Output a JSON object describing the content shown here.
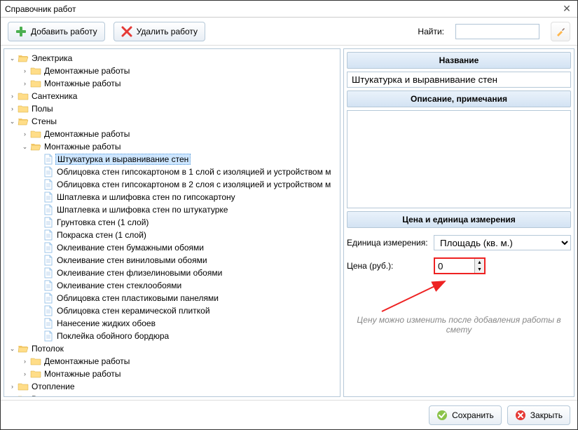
{
  "window": {
    "title": "Справочник работ"
  },
  "toolbar": {
    "add_label": "Добавить работу",
    "delete_label": "Удалить работу",
    "search_label": "Найти:"
  },
  "tree": [
    {
      "label": "Электрика",
      "icon": "folder-open",
      "expanded": true,
      "children": [
        {
          "label": "Демонтажные работы",
          "icon": "folder",
          "expanded": false,
          "children": true
        },
        {
          "label": "Монтажные работы",
          "icon": "folder",
          "expanded": false,
          "children": true
        }
      ]
    },
    {
      "label": "Сантехника",
      "icon": "folder",
      "expanded": false,
      "children": true
    },
    {
      "label": "Полы",
      "icon": "folder",
      "expanded": false,
      "children": true
    },
    {
      "label": "Стены",
      "icon": "folder-open",
      "expanded": true,
      "children": [
        {
          "label": "Демонтажные работы",
          "icon": "folder",
          "expanded": false,
          "children": true
        },
        {
          "label": "Монтажные работы",
          "icon": "folder-open",
          "expanded": true,
          "children": [
            {
              "label": "Штукатурка и выравнивание стен",
              "icon": "file",
              "selected": true
            },
            {
              "label": "Облицовка стен гипсокартоном в 1 слой с изоляцией и устройством м",
              "icon": "file"
            },
            {
              "label": "Облицовка стен гипсокартоном в 2 слоя с изоляцией и устройством м",
              "icon": "file"
            },
            {
              "label": "Шпатлевка и шлифовка стен по гипсокартону",
              "icon": "file"
            },
            {
              "label": "Шпатлевка и шлифовка стен по штукатурке",
              "icon": "file"
            },
            {
              "label": "Грунтовка стен (1 слой)",
              "icon": "file"
            },
            {
              "label": "Покраска стен (1 слой)",
              "icon": "file"
            },
            {
              "label": "Оклеивание стен бумажными обоями",
              "icon": "file"
            },
            {
              "label": "Оклеивание стен виниловыми обоями",
              "icon": "file"
            },
            {
              "label": "Оклеивание стен флизелиновыми обоями",
              "icon": "file"
            },
            {
              "label": "Оклеивание стен стеклообоями",
              "icon": "file"
            },
            {
              "label": "Облицовка стен пластиковыми панелями",
              "icon": "file"
            },
            {
              "label": "Облицовка стен керамической плиткой",
              "icon": "file"
            },
            {
              "label": "Нанесение жидких обоев",
              "icon": "file"
            },
            {
              "label": "Поклейка обойного бордюра",
              "icon": "file"
            }
          ]
        }
      ]
    },
    {
      "label": "Потолок",
      "icon": "folder-open",
      "expanded": true,
      "children": [
        {
          "label": "Демонтажные работы",
          "icon": "folder",
          "expanded": false,
          "children": true
        },
        {
          "label": "Монтажные работы",
          "icon": "folder",
          "expanded": false,
          "children": true
        }
      ]
    },
    {
      "label": "Отопление",
      "icon": "folder",
      "expanded": false,
      "children": true
    },
    {
      "label": "Вентиляция и кондицирование",
      "icon": "folder",
      "expanded": false,
      "children": true
    }
  ],
  "right": {
    "name_header": "Название",
    "name_value": "Штукатурка и выравнивание стен",
    "desc_header": "Описание, примечания",
    "desc_value": "",
    "price_header": "Цена и единица измерения",
    "unit_label": "Единица измерения:",
    "unit_value": "Площадь (кв. м.)",
    "price_label": "Цена (руб.):",
    "price_value": "0",
    "hint": "Цену можно изменить после добавления работы в смету"
  },
  "footer": {
    "save_label": "Сохранить",
    "close_label": "Закрыть"
  }
}
